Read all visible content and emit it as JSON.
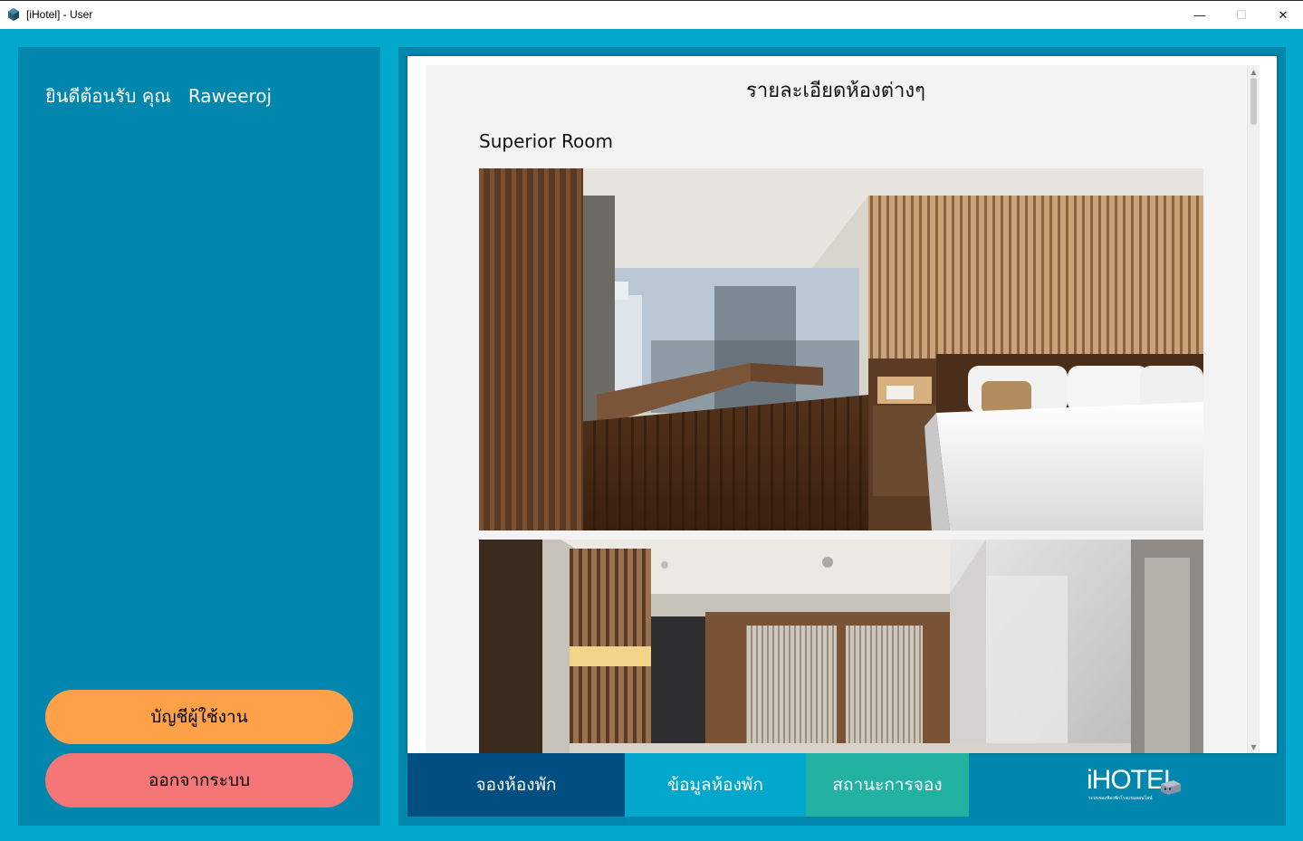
{
  "window": {
    "title": "[iHotel] - User",
    "minimize": "—",
    "maximize": "☐",
    "close": "✕"
  },
  "sidebar": {
    "welcome": "ยินดีต้อนรับ คุณ   Raweeroj",
    "account_button": "บัญชีผู้ใช้งาน",
    "logout_button": "ออกจากระบบ"
  },
  "content": {
    "heading": "รายละเอียดห้องต่างๆ",
    "room_title": "Superior  Room"
  },
  "nav": {
    "book": "จองห้องพัก",
    "rooms": "ข้อมูลห้องพัก",
    "status": "สถานะการจอง"
  },
  "logo": {
    "text": "iHOTEL",
    "subtitle": "ระบบจองห้องพักโรงแรมออนไลน์"
  },
  "colors": {
    "background": "#01a8cc",
    "panel": "#0186ad",
    "account_button": "#fea148",
    "logout_button": "#f57676",
    "nav_book": "#004e82",
    "nav_rooms": "#01a8cc",
    "nav_status": "#21b2a2"
  }
}
